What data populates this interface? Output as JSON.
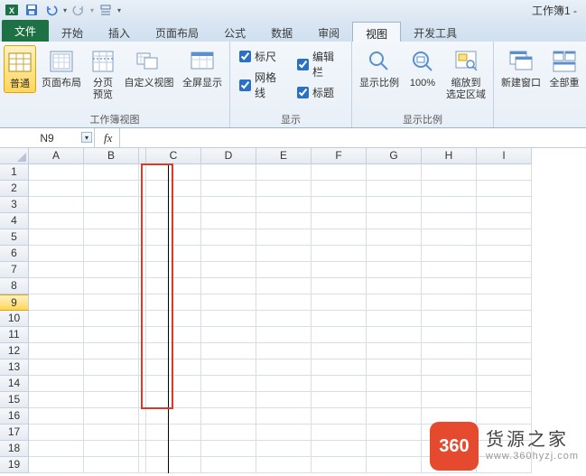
{
  "qat": {
    "workbook_name": "工作簿1 -"
  },
  "tabs": {
    "file": "文件",
    "items": [
      "开始",
      "插入",
      "页面布局",
      "公式",
      "数据",
      "审阅",
      "视图",
      "开发工具"
    ],
    "active_index": 6
  },
  "ribbon": {
    "group_views": {
      "label": "工作簿视图",
      "btns": {
        "normal": "普通",
        "page_layout": "页面布局",
        "page_break": "分页\n预览",
        "custom_views": "自定义视图",
        "full_screen": "全屏显示"
      }
    },
    "group_show": {
      "label": "显示",
      "checks": {
        "ruler": {
          "label": "标尺",
          "checked": true
        },
        "gridlines": {
          "label": "网格线",
          "checked": true
        },
        "formula_bar": {
          "label": "编辑栏",
          "checked": true
        },
        "headings": {
          "label": "标题",
          "checked": true
        }
      }
    },
    "group_zoom": {
      "label": "显示比例",
      "btns": {
        "zoom": "显示比例",
        "hundred": "100%",
        "zoom_selection": "缩放到\n选定区域"
      }
    },
    "group_window": {
      "btns": {
        "new_window": "新建窗口",
        "arrange_all": "全部重"
      }
    }
  },
  "formula_bar": {
    "name_box": "N9",
    "fx": "fx",
    "input": ""
  },
  "grid": {
    "columns": [
      "A",
      "B",
      "",
      "C",
      "D",
      "E",
      "F",
      "G",
      "H",
      "I"
    ],
    "narrow_col_index": 2,
    "rows": [
      "1",
      "2",
      "3",
      "4",
      "5",
      "6",
      "7",
      "8",
      "9",
      "10",
      "11",
      "12",
      "13",
      "14",
      "15",
      "16",
      "17",
      "18",
      "19"
    ],
    "active_row_index": 8
  },
  "watermark": {
    "badge": "360",
    "line1": "货源之家",
    "line2": "www.360hyzj.com"
  }
}
